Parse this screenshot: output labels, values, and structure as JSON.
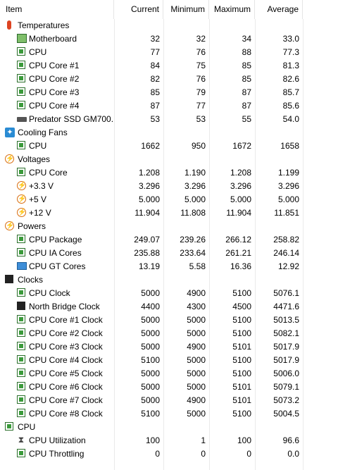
{
  "columns": {
    "item": "Item",
    "current": "Current",
    "minimum": "Minimum",
    "maximum": "Maximum",
    "average": "Average"
  },
  "groups": [
    {
      "label": "Temperatures",
      "icon": "thermometer-icon",
      "rows": [
        {
          "name": "Motherboard",
          "icon": "motherboard-icon",
          "current": "32",
          "minimum": "32",
          "maximum": "34",
          "average": "33.0"
        },
        {
          "name": "CPU",
          "icon": "chip-icon",
          "current": "77",
          "minimum": "76",
          "maximum": "88",
          "average": "77.3"
        },
        {
          "name": "CPU Core #1",
          "icon": "chip-icon",
          "current": "84",
          "minimum": "75",
          "maximum": "85",
          "average": "81.3"
        },
        {
          "name": "CPU Core #2",
          "icon": "chip-icon",
          "current": "82",
          "minimum": "76",
          "maximum": "85",
          "average": "82.6"
        },
        {
          "name": "CPU Core #3",
          "icon": "chip-icon",
          "current": "85",
          "minimum": "79",
          "maximum": "87",
          "average": "85.7"
        },
        {
          "name": "CPU Core #4",
          "icon": "chip-icon",
          "current": "87",
          "minimum": "77",
          "maximum": "87",
          "average": "85.6"
        },
        {
          "name": "Predator SSD GM700...",
          "icon": "ssd-icon",
          "current": "53",
          "minimum": "53",
          "maximum": "55",
          "average": "54.0"
        }
      ]
    },
    {
      "label": "Cooling Fans",
      "icon": "fan-icon",
      "rows": [
        {
          "name": "CPU",
          "icon": "chip-icon",
          "current": "1662",
          "minimum": "950",
          "maximum": "1672",
          "average": "1658"
        }
      ]
    },
    {
      "label": "Voltages",
      "icon": "voltage-icon",
      "rows": [
        {
          "name": "CPU Core",
          "icon": "chip-icon",
          "current": "1.208",
          "minimum": "1.190",
          "maximum": "1.208",
          "average": "1.199"
        },
        {
          "name": "+3.3 V",
          "icon": "voltage-icon",
          "current": "3.296",
          "minimum": "3.296",
          "maximum": "3.296",
          "average": "3.296"
        },
        {
          "name": "+5 V",
          "icon": "voltage-icon",
          "current": "5.000",
          "minimum": "5.000",
          "maximum": "5.000",
          "average": "5.000"
        },
        {
          "name": "+12 V",
          "icon": "voltage-icon",
          "current": "11.904",
          "minimum": "11.808",
          "maximum": "11.904",
          "average": "11.851"
        }
      ]
    },
    {
      "label": "Powers",
      "icon": "voltage-icon",
      "rows": [
        {
          "name": "CPU Package",
          "icon": "chip-icon",
          "current": "249.07",
          "minimum": "239.26",
          "maximum": "266.12",
          "average": "258.82"
        },
        {
          "name": "CPU IA Cores",
          "icon": "chip-icon",
          "current": "235.88",
          "minimum": "233.64",
          "maximum": "261.21",
          "average": "246.14"
        },
        {
          "name": "CPU GT Cores",
          "icon": "gpu-icon",
          "current": "13.19",
          "minimum": "5.58",
          "maximum": "16.36",
          "average": "12.92"
        }
      ]
    },
    {
      "label": "Clocks",
      "icon": "clock-icon",
      "rows": [
        {
          "name": "CPU Clock",
          "icon": "chip-icon",
          "current": "5000",
          "minimum": "4900",
          "maximum": "5100",
          "average": "5076.1"
        },
        {
          "name": "North Bridge Clock",
          "icon": "clock-icon",
          "current": "4400",
          "minimum": "4300",
          "maximum": "4500",
          "average": "4471.6"
        },
        {
          "name": "CPU Core #1 Clock",
          "icon": "chip-icon",
          "current": "5000",
          "minimum": "5000",
          "maximum": "5100",
          "average": "5013.5"
        },
        {
          "name": "CPU Core #2 Clock",
          "icon": "chip-icon",
          "current": "5000",
          "minimum": "5000",
          "maximum": "5100",
          "average": "5082.1"
        },
        {
          "name": "CPU Core #3 Clock",
          "icon": "chip-icon",
          "current": "5000",
          "minimum": "4900",
          "maximum": "5101",
          "average": "5017.9"
        },
        {
          "name": "CPU Core #4 Clock",
          "icon": "chip-icon",
          "current": "5100",
          "minimum": "5000",
          "maximum": "5100",
          "average": "5017.9"
        },
        {
          "name": "CPU Core #5 Clock",
          "icon": "chip-icon",
          "current": "5000",
          "minimum": "5000",
          "maximum": "5100",
          "average": "5006.0"
        },
        {
          "name": "CPU Core #6 Clock",
          "icon": "chip-icon",
          "current": "5000",
          "minimum": "5000",
          "maximum": "5101",
          "average": "5079.1"
        },
        {
          "name": "CPU Core #7 Clock",
          "icon": "chip-icon",
          "current": "5000",
          "minimum": "4900",
          "maximum": "5101",
          "average": "5073.2"
        },
        {
          "name": "CPU Core #8 Clock",
          "icon": "chip-icon",
          "current": "5100",
          "minimum": "5000",
          "maximum": "5100",
          "average": "5004.5"
        }
      ]
    },
    {
      "label": "CPU",
      "icon": "chip-icon",
      "rows": [
        {
          "name": "CPU Utilization",
          "icon": "hourglass-icon",
          "current": "100",
          "minimum": "1",
          "maximum": "100",
          "average": "96.6"
        },
        {
          "name": "CPU Throttling",
          "icon": "chip-icon",
          "current": "0",
          "minimum": "0",
          "maximum": "0",
          "average": "0.0"
        }
      ]
    }
  ]
}
